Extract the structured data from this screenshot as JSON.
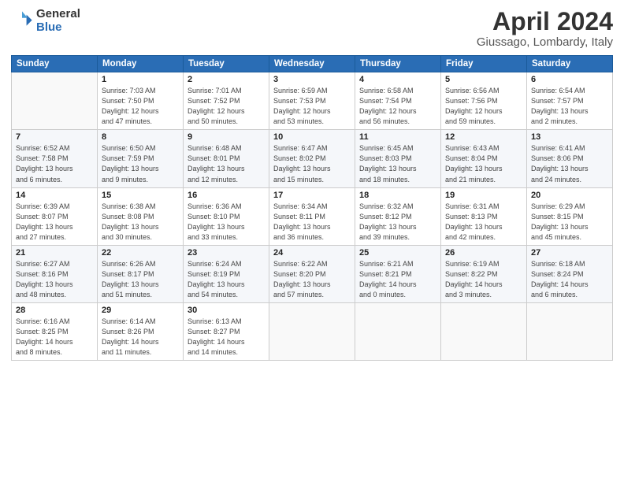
{
  "logo": {
    "general": "General",
    "blue": "Blue"
  },
  "title": "April 2024",
  "subtitle": "Giussago, Lombardy, Italy",
  "weekdays": [
    "Sunday",
    "Monday",
    "Tuesday",
    "Wednesday",
    "Thursday",
    "Friday",
    "Saturday"
  ],
  "weeks": [
    [
      {
        "day": "",
        "info": ""
      },
      {
        "day": "1",
        "info": "Sunrise: 7:03 AM\nSunset: 7:50 PM\nDaylight: 12 hours\nand 47 minutes."
      },
      {
        "day": "2",
        "info": "Sunrise: 7:01 AM\nSunset: 7:52 PM\nDaylight: 12 hours\nand 50 minutes."
      },
      {
        "day": "3",
        "info": "Sunrise: 6:59 AM\nSunset: 7:53 PM\nDaylight: 12 hours\nand 53 minutes."
      },
      {
        "day": "4",
        "info": "Sunrise: 6:58 AM\nSunset: 7:54 PM\nDaylight: 12 hours\nand 56 minutes."
      },
      {
        "day": "5",
        "info": "Sunrise: 6:56 AM\nSunset: 7:56 PM\nDaylight: 12 hours\nand 59 minutes."
      },
      {
        "day": "6",
        "info": "Sunrise: 6:54 AM\nSunset: 7:57 PM\nDaylight: 13 hours\nand 2 minutes."
      }
    ],
    [
      {
        "day": "7",
        "info": "Sunrise: 6:52 AM\nSunset: 7:58 PM\nDaylight: 13 hours\nand 6 minutes."
      },
      {
        "day": "8",
        "info": "Sunrise: 6:50 AM\nSunset: 7:59 PM\nDaylight: 13 hours\nand 9 minutes."
      },
      {
        "day": "9",
        "info": "Sunrise: 6:48 AM\nSunset: 8:01 PM\nDaylight: 13 hours\nand 12 minutes."
      },
      {
        "day": "10",
        "info": "Sunrise: 6:47 AM\nSunset: 8:02 PM\nDaylight: 13 hours\nand 15 minutes."
      },
      {
        "day": "11",
        "info": "Sunrise: 6:45 AM\nSunset: 8:03 PM\nDaylight: 13 hours\nand 18 minutes."
      },
      {
        "day": "12",
        "info": "Sunrise: 6:43 AM\nSunset: 8:04 PM\nDaylight: 13 hours\nand 21 minutes."
      },
      {
        "day": "13",
        "info": "Sunrise: 6:41 AM\nSunset: 8:06 PM\nDaylight: 13 hours\nand 24 minutes."
      }
    ],
    [
      {
        "day": "14",
        "info": "Sunrise: 6:39 AM\nSunset: 8:07 PM\nDaylight: 13 hours\nand 27 minutes."
      },
      {
        "day": "15",
        "info": "Sunrise: 6:38 AM\nSunset: 8:08 PM\nDaylight: 13 hours\nand 30 minutes."
      },
      {
        "day": "16",
        "info": "Sunrise: 6:36 AM\nSunset: 8:10 PM\nDaylight: 13 hours\nand 33 minutes."
      },
      {
        "day": "17",
        "info": "Sunrise: 6:34 AM\nSunset: 8:11 PM\nDaylight: 13 hours\nand 36 minutes."
      },
      {
        "day": "18",
        "info": "Sunrise: 6:32 AM\nSunset: 8:12 PM\nDaylight: 13 hours\nand 39 minutes."
      },
      {
        "day": "19",
        "info": "Sunrise: 6:31 AM\nSunset: 8:13 PM\nDaylight: 13 hours\nand 42 minutes."
      },
      {
        "day": "20",
        "info": "Sunrise: 6:29 AM\nSunset: 8:15 PM\nDaylight: 13 hours\nand 45 minutes."
      }
    ],
    [
      {
        "day": "21",
        "info": "Sunrise: 6:27 AM\nSunset: 8:16 PM\nDaylight: 13 hours\nand 48 minutes."
      },
      {
        "day": "22",
        "info": "Sunrise: 6:26 AM\nSunset: 8:17 PM\nDaylight: 13 hours\nand 51 minutes."
      },
      {
        "day": "23",
        "info": "Sunrise: 6:24 AM\nSunset: 8:19 PM\nDaylight: 13 hours\nand 54 minutes."
      },
      {
        "day": "24",
        "info": "Sunrise: 6:22 AM\nSunset: 8:20 PM\nDaylight: 13 hours\nand 57 minutes."
      },
      {
        "day": "25",
        "info": "Sunrise: 6:21 AM\nSunset: 8:21 PM\nDaylight: 14 hours\nand 0 minutes."
      },
      {
        "day": "26",
        "info": "Sunrise: 6:19 AM\nSunset: 8:22 PM\nDaylight: 14 hours\nand 3 minutes."
      },
      {
        "day": "27",
        "info": "Sunrise: 6:18 AM\nSunset: 8:24 PM\nDaylight: 14 hours\nand 6 minutes."
      }
    ],
    [
      {
        "day": "28",
        "info": "Sunrise: 6:16 AM\nSunset: 8:25 PM\nDaylight: 14 hours\nand 8 minutes."
      },
      {
        "day": "29",
        "info": "Sunrise: 6:14 AM\nSunset: 8:26 PM\nDaylight: 14 hours\nand 11 minutes."
      },
      {
        "day": "30",
        "info": "Sunrise: 6:13 AM\nSunset: 8:27 PM\nDaylight: 14 hours\nand 14 minutes."
      },
      {
        "day": "",
        "info": ""
      },
      {
        "day": "",
        "info": ""
      },
      {
        "day": "",
        "info": ""
      },
      {
        "day": "",
        "info": ""
      }
    ]
  ]
}
